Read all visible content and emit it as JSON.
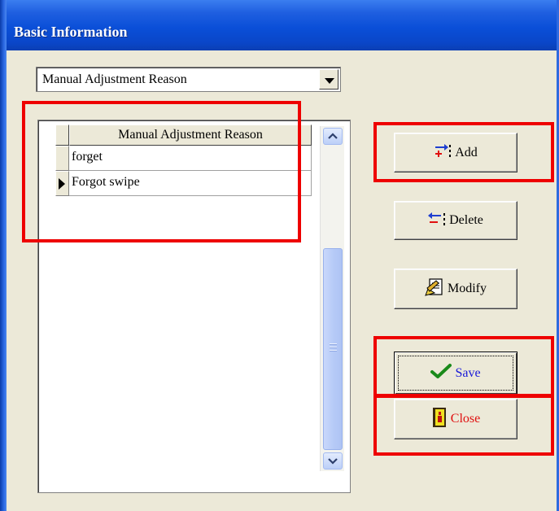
{
  "window": {
    "title": "Basic Information"
  },
  "selector": {
    "value": "Manual Adjustment Reason"
  },
  "grid": {
    "column_header": "Manual Adjustment Reason",
    "rows": [
      {
        "value": "forget",
        "current": false
      },
      {
        "value": "Forgot swipe",
        "current": true
      }
    ]
  },
  "buttons": {
    "add": "Add",
    "delete": "Delete",
    "modify": "Modify",
    "save": "Save",
    "close": "Close"
  },
  "colors": {
    "highlight": "#ee0000",
    "save_text": "#1a1ad8",
    "close_text": "#e01010"
  }
}
